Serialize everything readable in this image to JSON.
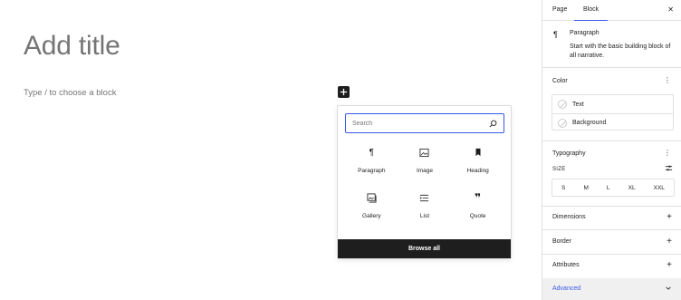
{
  "canvas": {
    "title_placeholder": "Add title",
    "paragraph_placeholder": "Type / to choose a block"
  },
  "inserter": {
    "search_placeholder": "Search",
    "blocks": [
      {
        "label": "Paragraph",
        "icon": "paragraph-icon"
      },
      {
        "label": "Image",
        "icon": "image-icon"
      },
      {
        "label": "Heading",
        "icon": "bookmark-icon"
      },
      {
        "label": "Gallery",
        "icon": "gallery-icon"
      },
      {
        "label": "List",
        "icon": "list-icon"
      },
      {
        "label": "Quote",
        "icon": "quote-icon"
      }
    ],
    "browse_all": "Browse all"
  },
  "sidebar": {
    "tabs": [
      "Page",
      "Block"
    ],
    "active_tab": "Block",
    "block_card": {
      "title": "Paragraph",
      "description": "Start with the basic building block of all narrative."
    },
    "color": {
      "title": "Color",
      "items": [
        "Text",
        "Background"
      ]
    },
    "typography": {
      "title": "Typography",
      "size_label": "SIZE",
      "sizes": [
        "S",
        "M",
        "L",
        "XL",
        "XXL"
      ]
    },
    "panels": [
      "Dimensions",
      "Border",
      "Attributes"
    ],
    "advanced": "Advanced"
  },
  "colors": {
    "accent": "#3858e9",
    "dark": "#1e1e1e",
    "muted": "#757575",
    "border": "#e0e0e0"
  }
}
